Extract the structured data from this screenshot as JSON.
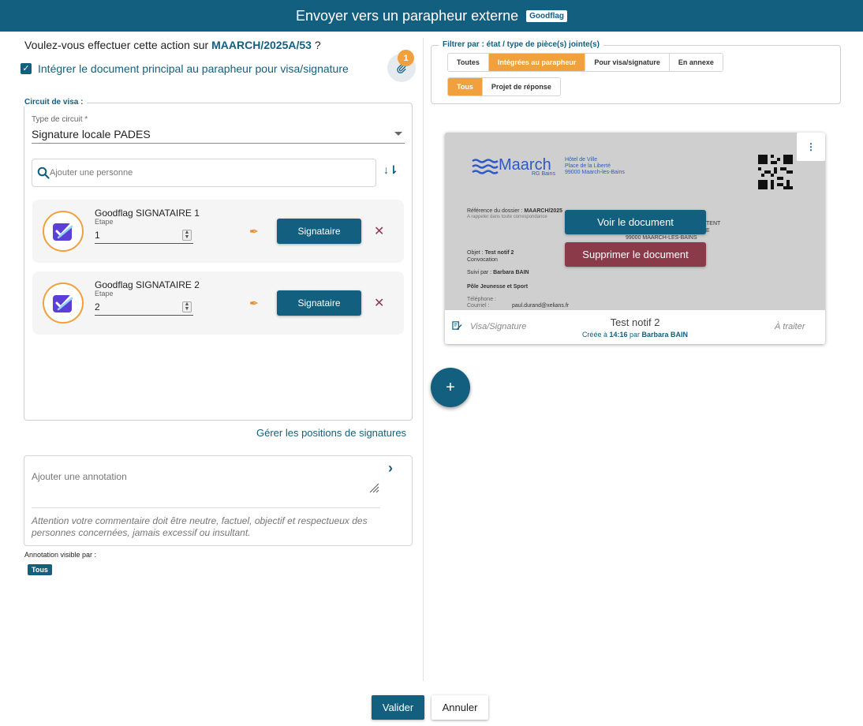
{
  "header": {
    "title": "Envoyer vers un parapheur externe",
    "badge": "Goodflag"
  },
  "question": {
    "prefix": "Voulez-vous effectuer cette action sur ",
    "reference": "MAARCH/2025A/53",
    "suffix": " ?"
  },
  "integrate": {
    "label": "Intégrer le document principal au parapheur pour visa/signature",
    "checked": true
  },
  "attachments": {
    "count": "1",
    "icon": "paperclip-icon"
  },
  "circuit": {
    "legend": "Circuit de visa :",
    "type_label": "Type de circuit *",
    "type_value": "Signature locale PADES",
    "search_placeholder": "Ajouter une personne",
    "signers": [
      {
        "name": "Goodflag SIGNATAIRE 1",
        "etape_label": "Etape",
        "etape": "1",
        "role_button": "Signataire"
      },
      {
        "name": "Goodflag SIGNATAIRE 2",
        "etape_label": "Etape",
        "etape": "2",
        "role_button": "Signataire"
      }
    ],
    "manage_link": "Gérer les positions de signatures"
  },
  "annotation": {
    "placeholder": "Ajouter une annotation",
    "warning": "Attention votre commentaire doit être neutre, factuel, objectif et respectueux des personnes concernées, jamais excessif ou insultant.",
    "visible_label": "Annotation visible par :",
    "visible_chip": "Tous"
  },
  "filter": {
    "legend": "Filtrer par : état / type de pièce(s) jointe(s)",
    "row1": [
      "Toutes",
      "Intégrées au parapheur",
      "Pour visa/signature",
      "En annexe"
    ],
    "row1_active": 1,
    "row2": [
      "Tous",
      "Projet de réponse"
    ],
    "row2_active": 0
  },
  "document": {
    "preview": {
      "logo_text": "Maarch",
      "logo_sub": "RG Bains",
      "address_lines": [
        "Hôtel de Ville",
        "Place de la Liberté",
        "99000 Maarch-les-Bains"
      ],
      "ref_label": "Référence du dossier :",
      "ref_value": "MAARCH/2025",
      "ref_note": "A rappeler dans toute correspondance",
      "recipient_1": "TENT",
      "recipient_2": "E",
      "recipient_city": "99000 MAARCH-LES-BAINS",
      "objet_label": "Objet :",
      "objet_value": "Test notif 2",
      "objet_line2": "Convocation",
      "suivi_label": "Suivi par :",
      "suivi_value": "Barbara BAIN",
      "pole": "Pôle Jeunesse et Sport",
      "tel_label": "Téléphone :",
      "courriel_label": "Courriel :",
      "courriel_value": "paul.durand@xelians.fr"
    },
    "view_button": "Voir le document",
    "delete_button": "Supprimer le document",
    "menu_icon": "more-vert-icon",
    "type_label": "Visa/Signature",
    "title": "Test notif 2",
    "created_prefix": "Créée à ",
    "created_time": "14:16",
    "created_by_prefix": " par ",
    "created_by": "Barbara BAIN",
    "status": "À traiter"
  },
  "add_button": "+",
  "footer": {
    "validate": "Valider",
    "cancel": "Annuler"
  },
  "colors": {
    "primary": "#135f7f",
    "accent": "#f0a03c",
    "danger": "#8b3a4a"
  }
}
